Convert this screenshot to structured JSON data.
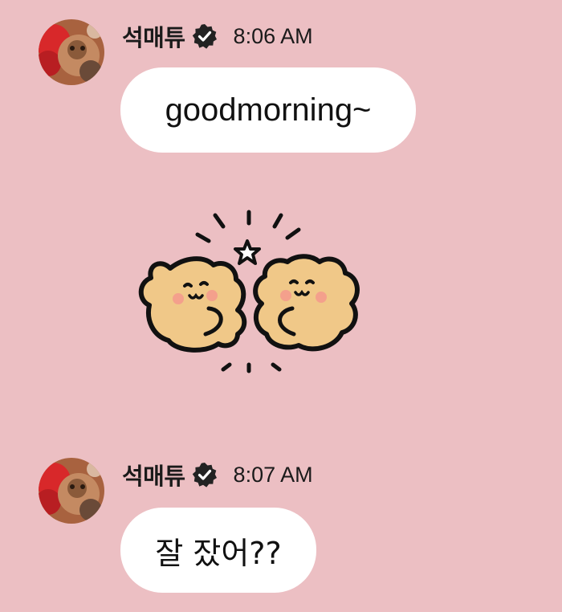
{
  "messages": [
    {
      "sender": "석매튜",
      "time": "8:06 AM",
      "text": "goodmorning~",
      "verified_icon": "verified-badge-icon",
      "avatar": "profile-photo"
    },
    {
      "sender": "석매튜",
      "time": "8:07 AM",
      "text": "잘 잤어??",
      "verified_icon": "verified-badge-icon",
      "avatar": "profile-photo"
    }
  ],
  "sticker": {
    "description_icon": "two-cheering-bears-sticker"
  },
  "colors": {
    "background": "#ecbfc3",
    "bubble": "#ffffff",
    "text": "#1a1a1a",
    "bear_fill": "#f0c888"
  }
}
